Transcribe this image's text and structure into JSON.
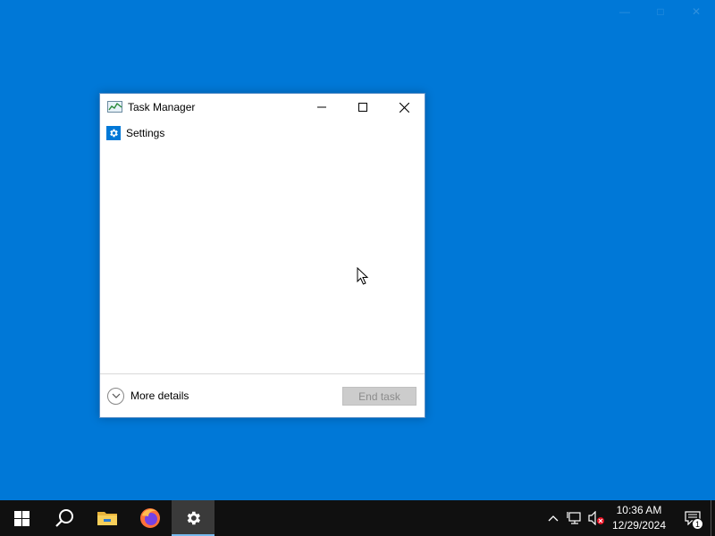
{
  "window": {
    "title": "Task Manager",
    "processes": [
      {
        "label": "Settings",
        "icon": "settings-gear-icon"
      }
    ],
    "footer": {
      "more_details_label": "More details",
      "end_task_label": "End task",
      "end_task_enabled": false
    }
  },
  "taskbar": {
    "apps": [
      {
        "name": "start",
        "icon": "windows-logo-icon"
      },
      {
        "name": "search",
        "icon": "search-icon"
      },
      {
        "name": "file-explorer",
        "icon": "folder-icon"
      },
      {
        "name": "firefox",
        "icon": "firefox-icon"
      },
      {
        "name": "settings",
        "icon": "gear-icon",
        "active": true
      }
    ],
    "clock": {
      "time": "10:36 AM",
      "date": "12/29/2024"
    },
    "notification_count": "1"
  },
  "colors": {
    "desktop": "#0078d7",
    "taskbar": "#101010",
    "accent": "#0078d7"
  }
}
